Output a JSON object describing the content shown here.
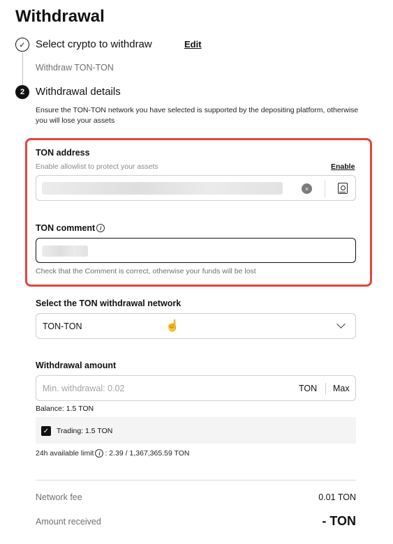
{
  "page": {
    "title": "Withdrawal"
  },
  "step1": {
    "number_icon": "check-icon",
    "label": "Select crypto to withdraw",
    "edit_label": "Edit",
    "selected": "Withdraw TON-TON"
  },
  "step2": {
    "number": "2",
    "label": "Withdrawal details",
    "warning": "Ensure the TON-TON network you have selected is supported by the depositing platform, otherwise you will lose your assets"
  },
  "address": {
    "label": "TON address",
    "hint": "Enable allowlist to protect your assets",
    "enable_label": "Enable",
    "clear_icon": "×"
  },
  "comment": {
    "label": "TON comment",
    "info_icon": "i",
    "hint": "Check that the Comment is correct, otherwise your funds will be lost"
  },
  "network": {
    "label": "Select the TON withdrawal network",
    "value": "TON-TON"
  },
  "amount": {
    "label": "Withdrawal amount",
    "placeholder": "Min. withdrawal: 0.02",
    "unit": "TON",
    "max_label": "Max",
    "balance": "Balance: 1.5 TON",
    "trading_label": "Trading: 1.5 TON",
    "checkbox_mark": "✓",
    "limit_label": "24h available limit",
    "limit_value": ": 2.39 / 1,367,365.59 TON"
  },
  "summary": {
    "fee_label": "Network fee",
    "fee_value": "0.01 TON",
    "received_label": "Amount received",
    "received_value": "- TON"
  },
  "colors": {
    "highlight": "#e8423d",
    "text": "#111111",
    "muted": "#707070"
  }
}
